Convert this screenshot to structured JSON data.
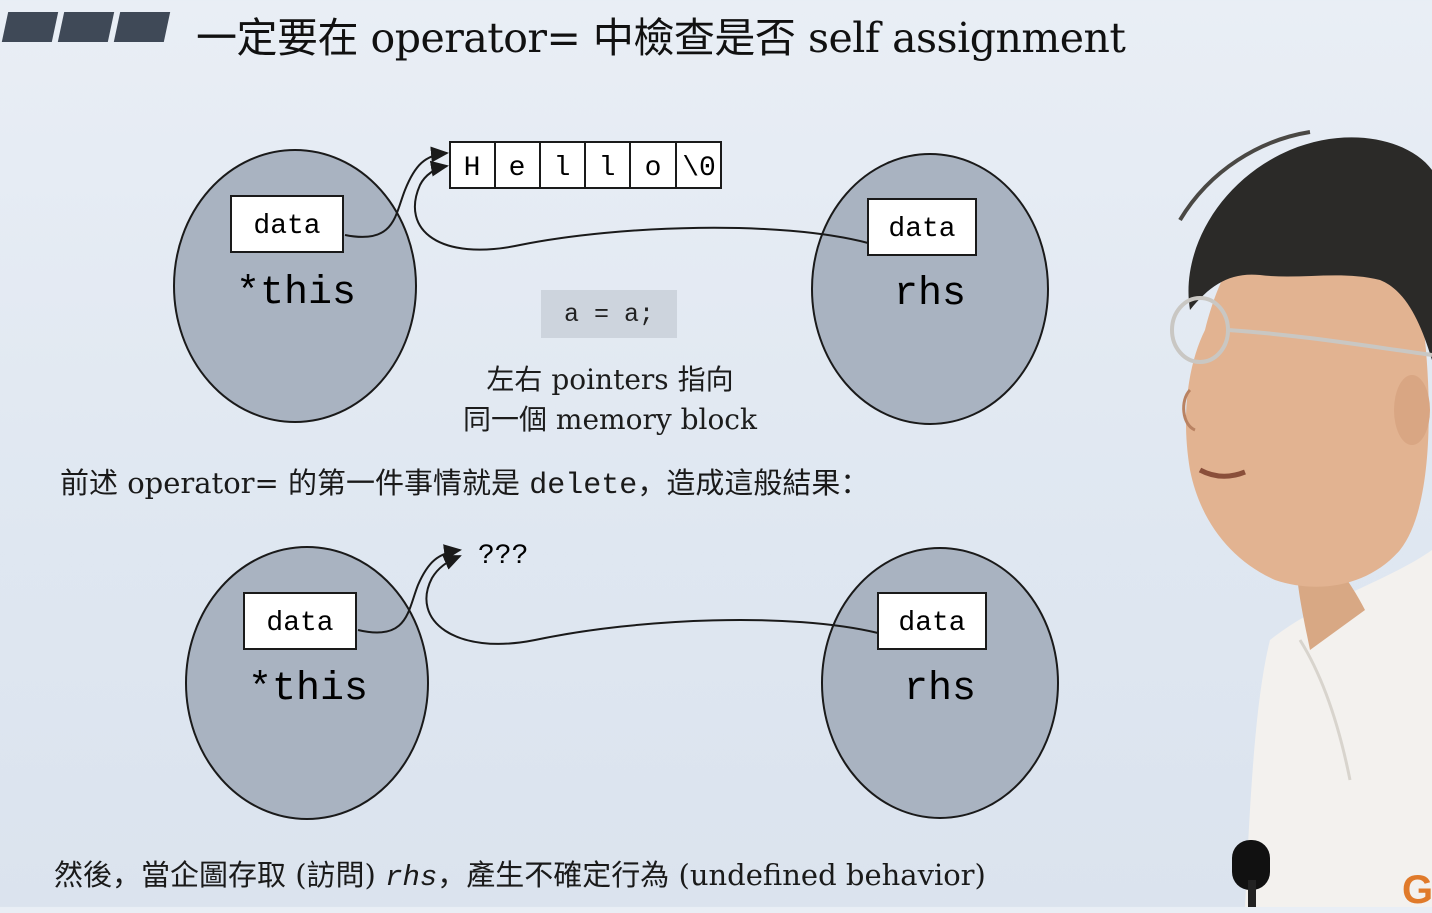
{
  "slide": {
    "title": "一定要在 operator= 中檢查是否 self assignment",
    "cells": [
      "H",
      "e",
      "l",
      "l",
      "o",
      "\\0"
    ],
    "top": {
      "left_box": "data",
      "left_label": "*this",
      "right_box": "data",
      "right_label": "rhs"
    },
    "code": "a = a;",
    "caption_line1": "左右 pointers 指向",
    "caption_line2": "同一個 memory block",
    "middle_text": {
      "prefix": "前述 operator= 的第一件事情就是 ",
      "code": "delete",
      "suffix": "，造成這般結果："
    },
    "unknown": "???",
    "bottom": {
      "left_box": "data",
      "left_label": "*this",
      "right_box": "data",
      "right_label": "rhs"
    },
    "bottom_text": {
      "prefix": "然後，當企圖存取 (訪問) ",
      "code": "rhs",
      "suffix": "，產生不確定行為 (undefined behavior)"
    },
    "logo": "G"
  },
  "colors": {
    "ellipse_fill": "#a9b3c1",
    "box_fill": "#ffffff",
    "ink": "#1a1a1a"
  }
}
